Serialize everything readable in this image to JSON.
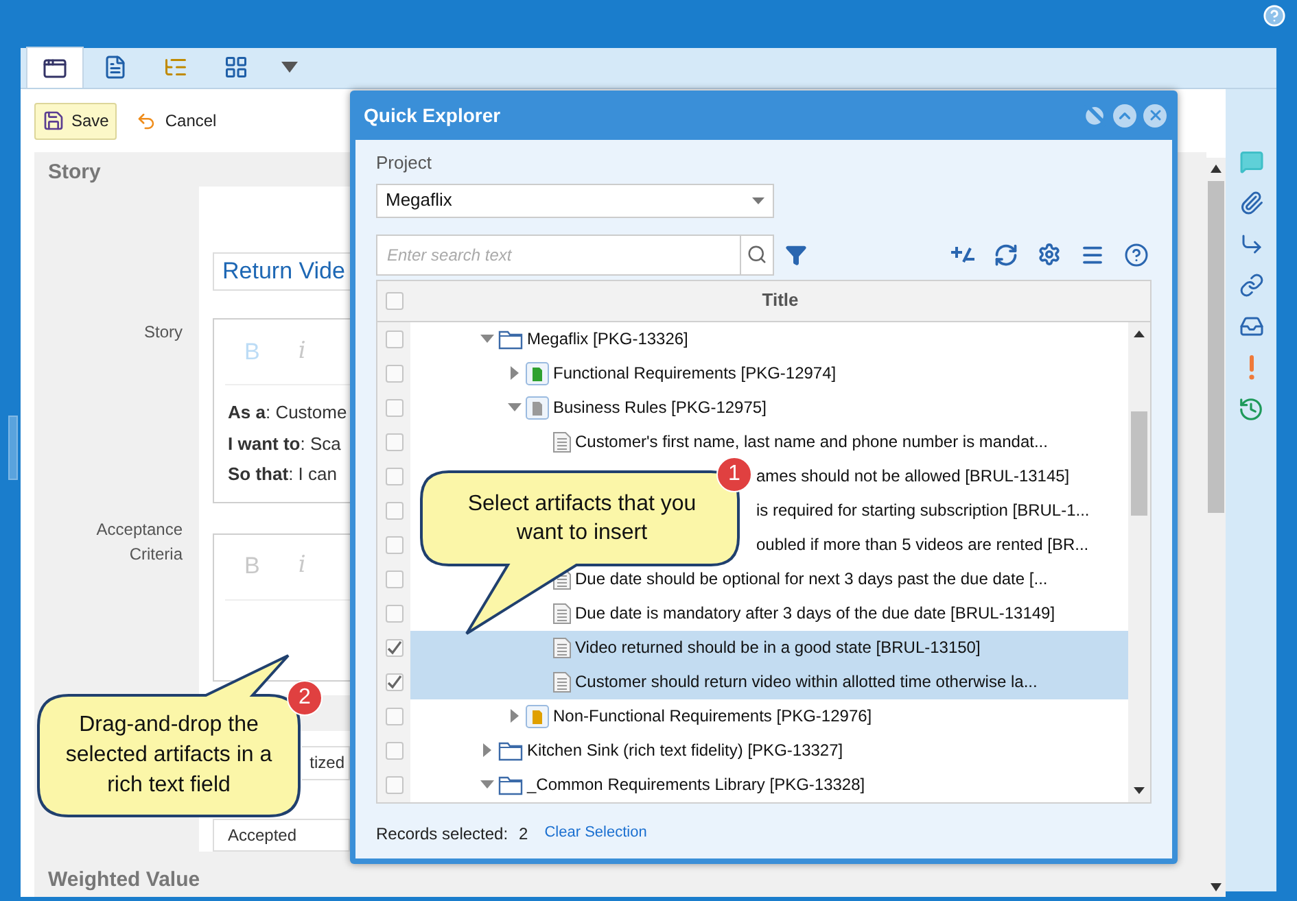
{
  "tabs": [
    {
      "kind": "form",
      "selected": true
    },
    {
      "kind": "document",
      "selected": false
    },
    {
      "kind": "tree",
      "selected": false
    },
    {
      "kind": "grid",
      "selected": false
    }
  ],
  "toolbar": {
    "save": "Save",
    "cancel": "Cancel"
  },
  "form": {
    "section": "Story",
    "name_value": "Return Vide",
    "story_label": "Story",
    "story_editor": {
      "bold": "B",
      "italic": "i",
      "active": true,
      "lines": [
        "**As a**: Custome",
        "**I want to**: Sca",
        "**So that**: I can"
      ]
    },
    "criteria_label": "Acceptance Criteria",
    "criteria_editor": {
      "bold": "B",
      "italic": "i",
      "active": false
    },
    "status_fields": [
      "tized",
      "Accepted"
    ],
    "next_section": "Weighted Value"
  },
  "dialog": {
    "title": "Quick Explorer",
    "project_label": "Project",
    "project": "Megaflix",
    "search_placeholder": "Enter search text",
    "column": "Title",
    "header_checked": false,
    "tree": [
      {
        "kind": "folder",
        "label": "Megaflix [PKG-13326]",
        "expanded": true,
        "checked": false,
        "selected": false,
        "children": [
          {
            "kind": "package",
            "color": "#2fa12f",
            "label": "Functional Requirements [PKG-12974]",
            "expanded": false,
            "checked": false,
            "selected": false
          },
          {
            "kind": "package",
            "color": "#9a9a9a",
            "label": "Business Rules [PKG-12975]",
            "expanded": true,
            "checked": false,
            "selected": false,
            "children": [
              {
                "kind": "document",
                "label": "Customer's first name, last name and phone number is mandat...",
                "checked": false,
                "selected": false
              },
              {
                "kind": "covered",
                "label": "ames should not be allowed [BRUL-13145]",
                "checked": false,
                "selected": false
              },
              {
                "kind": "covered",
                "label": "is required for starting subscription [BRUL-1...",
                "checked": false,
                "selected": false
              },
              {
                "kind": "covered",
                "label": "oubled if more than 5 videos are rented [BR...",
                "checked": false,
                "selected": false
              },
              {
                "kind": "document",
                "label": "Due date should be optional for next 3 days past the due date [...",
                "checked": false,
                "selected": false
              },
              {
                "kind": "document",
                "label": "Due date is mandatory after 3 days of the due date [BRUL-13149]",
                "checked": false,
                "selected": false
              },
              {
                "kind": "document",
                "label": "Video returned should be in a good state [BRUL-13150]",
                "checked": true,
                "selected": true
              },
              {
                "kind": "document",
                "label": "Customer should return video within allotted time otherwise la...",
                "checked": true,
                "selected": true
              }
            ]
          },
          {
            "kind": "package",
            "color": "#e0a000",
            "label": "Non-Functional Requirements [PKG-12976]",
            "expanded": false,
            "checked": false,
            "selected": false
          }
        ]
      },
      {
        "kind": "folder",
        "label": "Kitchen Sink (rich text fidelity) [PKG-13327]",
        "expanded": false,
        "checked": false,
        "selected": false
      },
      {
        "kind": "folder",
        "label": "_Common Requirements Library [PKG-13328]",
        "expanded": true,
        "checked": false,
        "selected": false
      }
    ],
    "records_label": "Records selected:",
    "records_count": "2",
    "clear": "Clear Selection"
  },
  "callouts": [
    {
      "number": "1",
      "text": "Select artifacts that you want to insert"
    },
    {
      "number": "2",
      "text": "Drag-and-drop the selected artifacts in a rich text field"
    }
  ]
}
